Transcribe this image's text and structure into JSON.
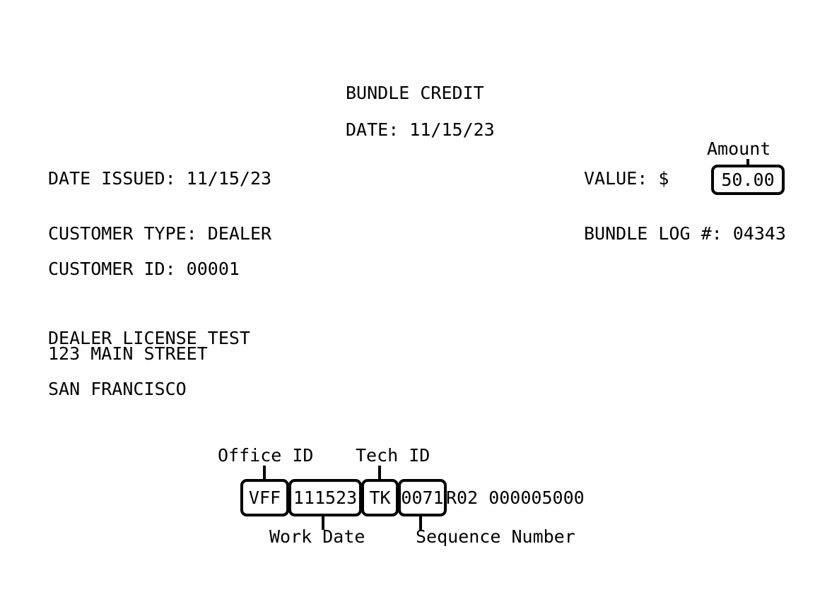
{
  "header": {
    "title": "BUNDLE CREDIT",
    "date_line": "DATE: 11/15/23"
  },
  "fields": {
    "date_issued": "DATE ISSUED: 11/15/23",
    "customer_type": "CUSTOMER TYPE: DEALER",
    "customer_id": "CUSTOMER ID: 00001",
    "value": "VALUE: $",
    "bundle_log": "BUNDLE LOG #: 04343"
  },
  "amount": {
    "label": "Amount",
    "value": "50.00"
  },
  "address": {
    "name_and_street": "DEALER LICENSE TEST\n123 MAIN STREET",
    "city": "SAN FRANCISCO"
  },
  "code": {
    "office_id": "VFF",
    "work_date": "111523",
    "tech_id": "TK",
    "sequence_number": "0071",
    "tail": "R02 000005000",
    "annotations": {
      "office_id": "Office ID",
      "tech_id": "Tech ID",
      "work_date": "Work Date",
      "sequence_number": "Sequence Number"
    }
  },
  "colors": {
    "ink": "#000000",
    "paper": "#ffffff"
  }
}
